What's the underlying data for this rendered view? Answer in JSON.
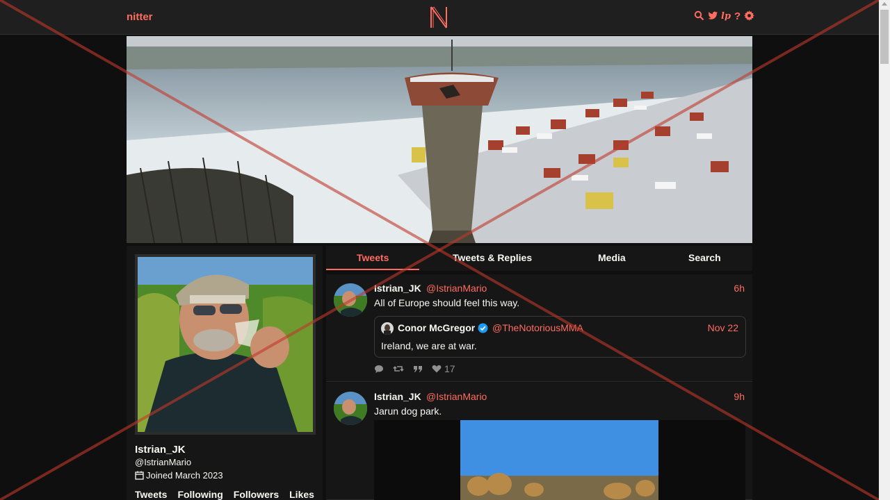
{
  "nav": {
    "brand": "nitter",
    "icons": [
      "search-icon",
      "twitter-icon",
      "lp-icon",
      "help-icon",
      "gear-icon"
    ]
  },
  "profile": {
    "fullname": "Istrian_JK",
    "username": "@IstrianMario",
    "joined": "Joined March 2023",
    "stats": [
      "Tweets",
      "Following",
      "Followers",
      "Likes"
    ]
  },
  "tabs": [
    "Tweets",
    "Tweets & Replies",
    "Media",
    "Search"
  ],
  "tweets": [
    {
      "fullname": "Istrian_JK",
      "username": "@IstrianMario",
      "date": "6h",
      "text": "All of Europe should feel this way.",
      "quote": {
        "fullname": "Conor McGregor",
        "username": "@TheNotoriousMMA",
        "date": "Nov 22",
        "text": "Ireland, we are at war."
      },
      "likes": "17"
    },
    {
      "fullname": "Istrian_JK",
      "username": "@IstrianMario",
      "date": "9h",
      "text": "Jarun dog park."
    }
  ],
  "colors": {
    "accent": "#ff6c60",
    "background": "#0f0f0f",
    "panel": "#161616",
    "nav": "#1f1f1f",
    "overlay_cross": "#c0392b"
  }
}
